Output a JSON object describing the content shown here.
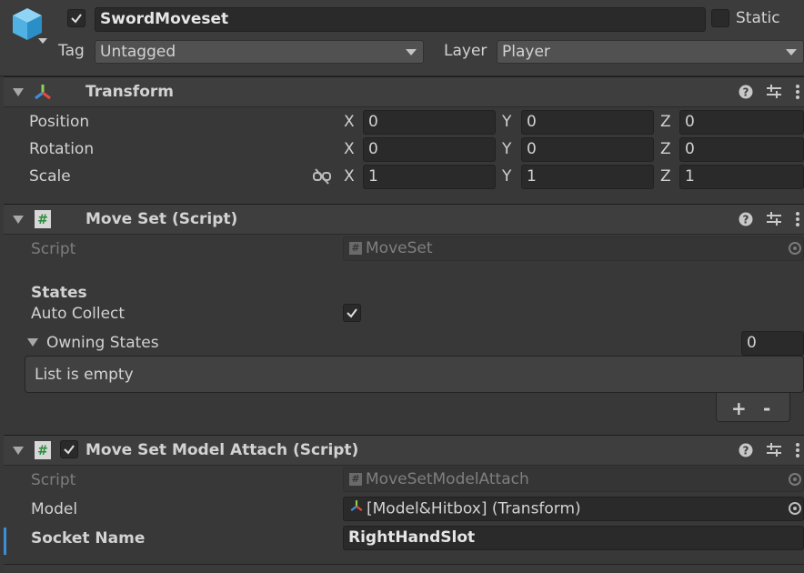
{
  "header": {
    "object_name": "SwordMoveset",
    "active": true,
    "static_label": "Static",
    "tag_label": "Tag",
    "tag_value": "Untagged",
    "layer_label": "Layer",
    "layer_value": "Player"
  },
  "transform": {
    "title": "Transform",
    "rows": [
      {
        "label": "Position",
        "x": "0",
        "y": "0",
        "z": "0"
      },
      {
        "label": "Rotation",
        "x": "0",
        "y": "0",
        "z": "0"
      },
      {
        "label": "Scale",
        "x": "1",
        "y": "1",
        "z": "1"
      }
    ],
    "axis_x": "X",
    "axis_y": "Y",
    "axis_z": "Z"
  },
  "move_set": {
    "title": "Move Set (Script)",
    "script_label": "Script",
    "script_value": "MoveSet",
    "states_header": "States",
    "auto_collect_label": "Auto Collect",
    "auto_collect": true,
    "owning_states_label": "Owning States",
    "owning_states_count": "0",
    "list_empty_text": "List is empty",
    "add_label": "+",
    "remove_label": "-"
  },
  "model_attach": {
    "title": "Move Set Model Attach (Script)",
    "enabled": true,
    "script_label": "Script",
    "script_value": "MoveSetModelAttach",
    "model_label": "Model",
    "model_value": "[Model&Hitbox] (Transform)",
    "socket_label": "Socket Name",
    "socket_value": "RightHandSlot"
  },
  "colors": {
    "background": "#383838",
    "header": "#3e3e3e",
    "field": "#2a2a2a",
    "accent": "#3b8fd9"
  }
}
